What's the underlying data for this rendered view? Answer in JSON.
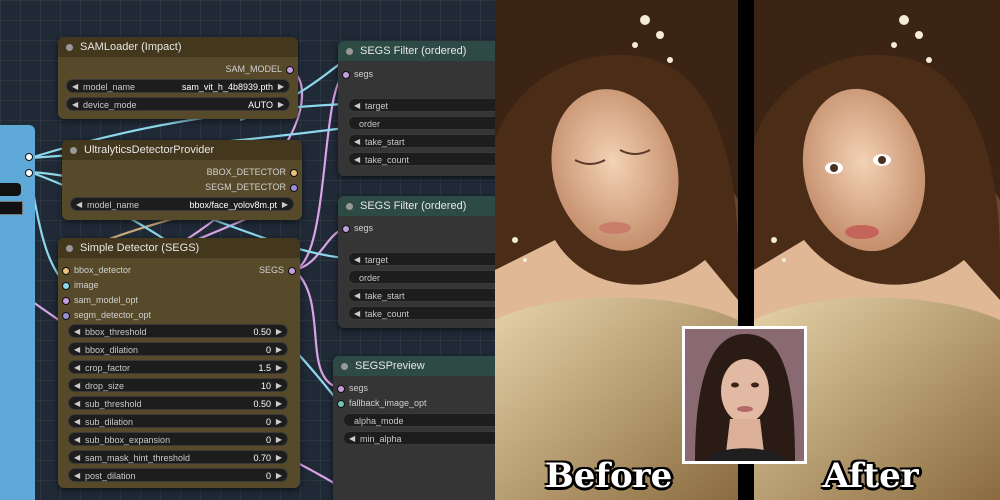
{
  "nodes": {
    "sam_loader": {
      "title": "SAMLoader (Impact)",
      "output": "SAM_MODEL",
      "widgets": [
        {
          "label": "model_name",
          "value": "sam_vit_h_4b8939.pth"
        },
        {
          "label": "device_mode",
          "value": "AUTO"
        }
      ]
    },
    "ultralytics": {
      "title": "UltralyticsDetectorProvider",
      "outputs": [
        "BBOX_DETECTOR",
        "SEGM_DETECTOR"
      ],
      "widgets": [
        {
          "label": "model_name",
          "value": "bbox/face_yolov8m.pt"
        }
      ]
    },
    "simple_detector": {
      "title": "Simple Detector (SEGS)",
      "inputs": [
        "bbox_detector",
        "image",
        "sam_model_opt",
        "segm_detector_opt"
      ],
      "output": "SEGS",
      "widgets": [
        {
          "label": "bbox_threshold",
          "value": "0.50"
        },
        {
          "label": "bbox_dilation",
          "value": "0"
        },
        {
          "label": "crop_factor",
          "value": "1.5"
        },
        {
          "label": "drop_size",
          "value": "10"
        },
        {
          "label": "sub_threshold",
          "value": "0.50"
        },
        {
          "label": "sub_dilation",
          "value": "0"
        },
        {
          "label": "sub_bbox_expansion",
          "value": "0"
        },
        {
          "label": "sam_mask_hint_threshold",
          "value": "0.70"
        },
        {
          "label": "post_dilation",
          "value": "0"
        }
      ]
    },
    "segs_filter_1": {
      "title": "SEGS Filter (ordered)",
      "input": "segs",
      "widgets": [
        "target",
        "order",
        "take_start",
        "take_count"
      ]
    },
    "segs_filter_2": {
      "title": "SEGS Filter (ordered)",
      "input": "segs",
      "widgets": [
        "target",
        "order",
        "take_start",
        "take_count"
      ]
    },
    "segs_preview": {
      "title": "SEGSPreview",
      "inputs": [
        "segs",
        "fallback_image_opt"
      ],
      "widgets": [
        "alpha_mode",
        "min_alpha"
      ]
    }
  },
  "captions": {
    "before": "Before",
    "after": "After"
  },
  "colors": {
    "node_brown": "#574a2b",
    "node_gray": "#353535",
    "wire_blue": "#8fd8ec",
    "wire_pink": "#d9a3e6",
    "wire_tan": "#c9a97a",
    "left_panel": "#5fa9d8"
  }
}
